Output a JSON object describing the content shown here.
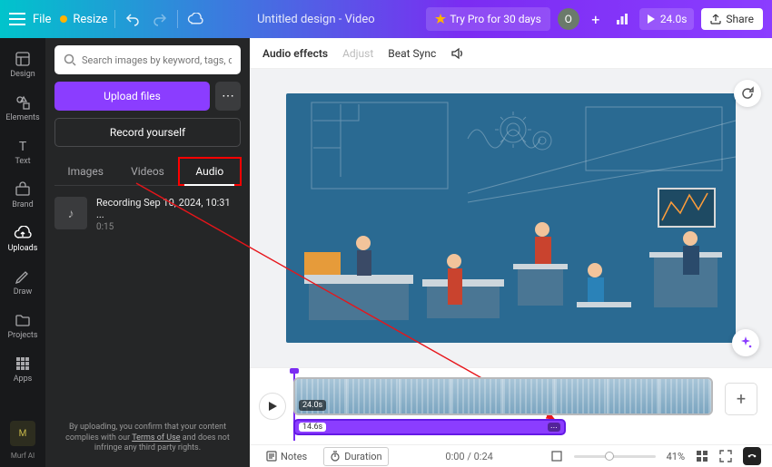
{
  "topbar": {
    "file": "File",
    "resize": "Resize",
    "title": "Untitled design - Video",
    "try": "Try Pro for 30 days",
    "avatar_initial": "O",
    "play_duration": "24.0s",
    "share": "Share"
  },
  "rail": {
    "items": [
      {
        "label": "Design",
        "icon": "layout"
      },
      {
        "label": "Elements",
        "icon": "shapes"
      },
      {
        "label": "Text",
        "icon": "text"
      },
      {
        "label": "Brand",
        "icon": "briefcase"
      },
      {
        "label": "Uploads",
        "icon": "cloud"
      },
      {
        "label": "Draw",
        "icon": "pencil"
      },
      {
        "label": "Projects",
        "icon": "folder"
      },
      {
        "label": "Apps",
        "icon": "grid"
      }
    ],
    "active_index": 4,
    "murf_label": "M"
  },
  "panel": {
    "search_placeholder": "Search images by keyword, tags, color...",
    "upload_label": "Upload files",
    "record_label": "Record yourself",
    "tabs": [
      "Images",
      "Videos",
      "Audio"
    ],
    "active_tab": 2,
    "audio_item": {
      "name": "Recording Sep 10, 2024, 10:31 ...",
      "duration": "0:15"
    },
    "disclaimer_a": "By uploading, you confirm that your content complies with our",
    "disclaimer_link": "Terms of Use",
    "disclaimer_b": " and does not infringe any third party rights."
  },
  "effects": {
    "title": "Audio effects",
    "adjust": "Adjust",
    "beat": "Beat Sync"
  },
  "timeline": {
    "video_badge": "24.0s",
    "audio_badge": "14.6s",
    "footer": {
      "notes": "Notes",
      "duration": "Duration",
      "time": "0:00 / 0:24",
      "zoom": "41%"
    }
  }
}
